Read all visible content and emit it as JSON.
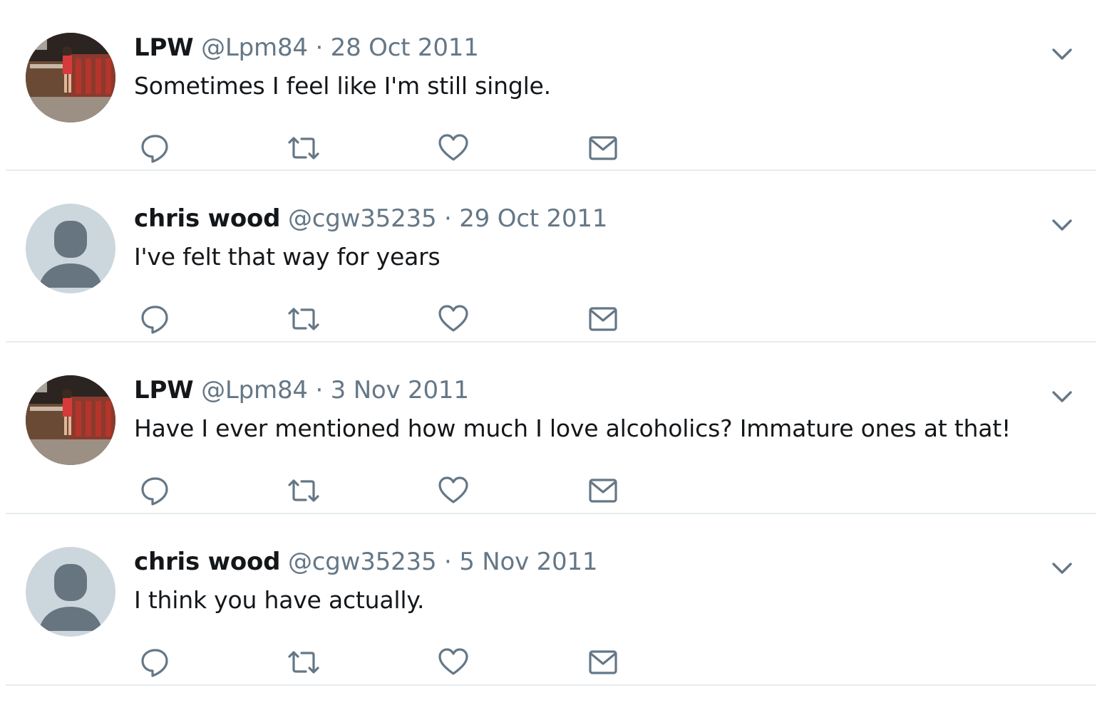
{
  "tweets": [
    {
      "name": "LPW",
      "handle": "@Lpm84",
      "separator": "·",
      "date": "28 Oct 2011",
      "text": "Sometimes I feel like I'm still single.",
      "avatar": "photo"
    },
    {
      "name": "chris wood",
      "handle": "@cgw35235",
      "separator": "·",
      "date": "29 Oct 2011",
      "text": "I've felt that way for years",
      "avatar": "default"
    },
    {
      "name": "LPW",
      "handle": "@Lpm84",
      "separator": "·",
      "date": "3 Nov 2011",
      "text": "Have I ever mentioned how much I love alcoholics? Immature ones at that!",
      "avatar": "photo"
    },
    {
      "name": "chris wood",
      "handle": "@cgw35235",
      "separator": "·",
      "date": "5 Nov 2011",
      "text": "I think you have actually.",
      "avatar": "default"
    }
  ],
  "icons": {
    "reply": "reply-icon",
    "retweet": "retweet-icon",
    "like": "heart-icon",
    "dm": "envelope-icon",
    "menu": "chevron-down-icon"
  },
  "colors": {
    "name": "#14171a",
    "meta": "#657786",
    "icon": "#657786",
    "divider": "#e6ecf0",
    "default_avatar_bg": "#ccd6dd",
    "default_avatar_fg": "#66757f"
  }
}
